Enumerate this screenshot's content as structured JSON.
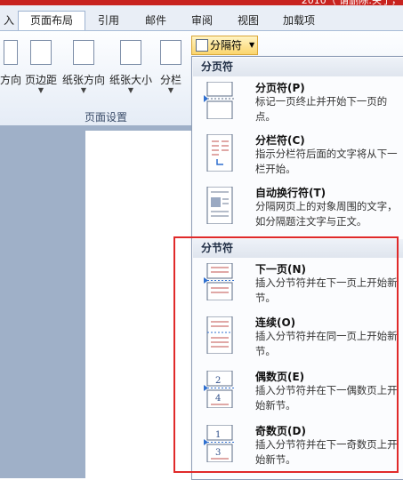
{
  "window": {
    "title_text": "2010（ 请删除:关了，"
  },
  "tabs": [
    {
      "label": "入"
    },
    {
      "label": "页面布局"
    },
    {
      "label": "引用"
    },
    {
      "label": "邮件"
    },
    {
      "label": "审阅"
    },
    {
      "label": "视图"
    },
    {
      "label": "加载项"
    }
  ],
  "ribbon": {
    "buttons": [
      {
        "label": "方向"
      },
      {
        "label": "页边距"
      },
      {
        "label": "纸张方向"
      },
      {
        "label": "纸张大小"
      },
      {
        "label": "分栏"
      }
    ],
    "group_label": "页面设置",
    "separator_button": {
      "label": "分隔符"
    }
  },
  "menu": {
    "page_break_header": "分页符",
    "page_break_items": [
      {
        "title": "分页符(P)",
        "desc": "标记一页终止并开始下一页的点。"
      },
      {
        "title": "分栏符(C)",
        "desc": "指示分栏符后面的文字将从下一栏开始。"
      },
      {
        "title": "自动换行符(T)",
        "desc": "分隔网页上的对象周围的文字，如分隔题注文字与正文。"
      }
    ],
    "section_break_header": "分节符",
    "section_break_items": [
      {
        "title": "下一页(N)",
        "desc": "插入分节符并在下一页上开始新节。"
      },
      {
        "title": "连续(O)",
        "desc": "插入分节符并在同一页上开始新节。"
      },
      {
        "title": "偶数页(E)",
        "desc": "插入分节符并在下一偶数页上开始新节。"
      },
      {
        "title": "奇数页(D)",
        "desc": "插入分节符并在下一奇数页上开始新节。"
      }
    ]
  },
  "icon_labels": {
    "even_page_numbers": [
      "2",
      "4"
    ],
    "odd_page_numbers": [
      "1",
      "3"
    ]
  },
  "colors": {
    "accent_red": "#e02a2a",
    "brand_title": "#c8231f"
  }
}
